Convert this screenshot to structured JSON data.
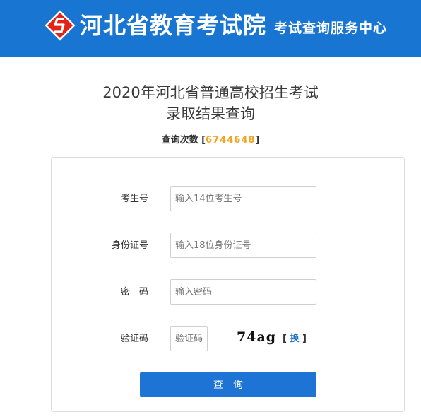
{
  "header": {
    "brand": "河北省教育考试院",
    "service": "考试查询服务中心",
    "logo_icon": "hebei-exam-logo-icon",
    "accent_color": "#1875d2",
    "logo_color": "#e2231a"
  },
  "title": {
    "line1": "2020年河北省普通高校招生考试",
    "line2": "录取结果查询"
  },
  "counter": {
    "label": "查询次数",
    "open": "[",
    "value": "6744648",
    "close": "]",
    "value_color": "#f2a41c"
  },
  "form": {
    "exam_no": {
      "label": "考生号",
      "placeholder": "输入14位考生号",
      "value": ""
    },
    "id_no": {
      "label": "身份证号",
      "placeholder": "输入18位身份证号",
      "value": ""
    },
    "password": {
      "label": "密　码",
      "placeholder": "输入密码",
      "value": ""
    },
    "captcha": {
      "label": "验证码",
      "placeholder": "验证码",
      "value": "",
      "image_text": "74ag",
      "refresh_open": "[",
      "refresh_label": "换",
      "refresh_close": "]"
    },
    "submit_label": "查　询",
    "button_color": "#1e74d5"
  }
}
